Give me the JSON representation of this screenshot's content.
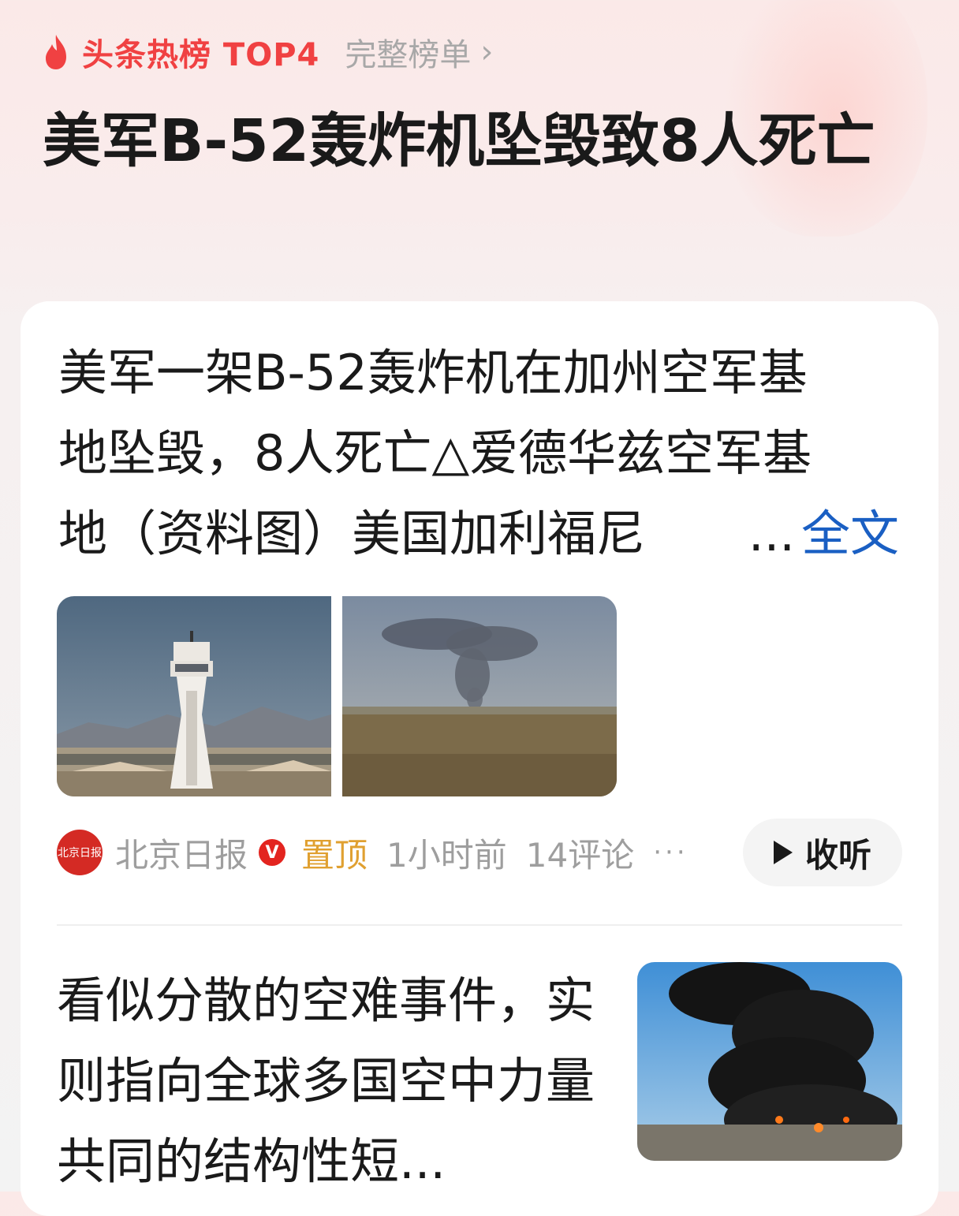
{
  "header": {
    "hot_label": "头条热榜 TOP4",
    "full_list_label": "完整榜单",
    "chevron": "›",
    "headline": "美军B-52轰炸机坠毁致8人死亡"
  },
  "card": {
    "summary_line1": "美军一架B-52轰炸机在加州空军基",
    "summary_line2": "地坠毁，8人死亡△爱德华兹空军基",
    "summary_line3": "地（资料图）美国加利福尼",
    "more_dots": "...",
    "more_label": "全文",
    "meta": {
      "avatar_text": "北京日报",
      "source": "北京日报",
      "verified_badge": "V",
      "pinned": "置顶",
      "time": "1小时前",
      "comments": "14评论",
      "more_icon": "···",
      "listen_label": "收听"
    }
  },
  "next_article": {
    "title": "看似分散的空难事件，实则指向全球多国空中力量共同的结构性短..."
  },
  "colors": {
    "accent_red": "#f04142",
    "link_blue": "#1a5fc3",
    "pinned_gold": "#e0a030"
  }
}
